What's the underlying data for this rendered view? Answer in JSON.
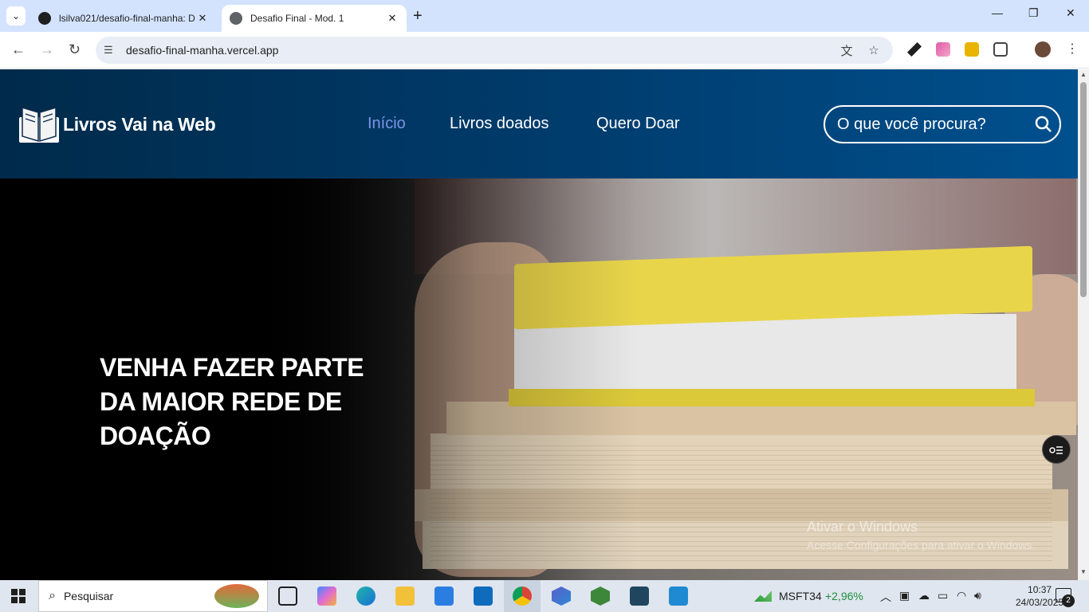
{
  "browser": {
    "tabs": [
      {
        "title": "lsilva021/desafio-final-manha: D",
        "icon": "github-icon"
      },
      {
        "title": "Desafio Final - Mod. 1",
        "icon": "globe-icon"
      }
    ],
    "url": "desafio-final-manha.vercel.app"
  },
  "site": {
    "logo_text": "Livros Vai na Web",
    "nav": [
      "Início",
      "Livros doados",
      "Quero Doar"
    ],
    "active_nav": "Início",
    "search_placeholder": "O que você procura?",
    "hero_title": "VENHA FAZER PARTE DA MAIOR REDE DE DOAÇÃO"
  },
  "watermark": {
    "line1": "Ativar o Windows",
    "line2": "Acesse Configurações para ativar o Windows."
  },
  "taskbar": {
    "search_text": "Pesquisar",
    "stock_symbol": "MSFT34",
    "stock_change": "+2,96%",
    "time": "10:37",
    "date": "24/03/2025",
    "notifications": "2"
  },
  "colors": {
    "header_start": "#002a4a",
    "header_end": "#00508e",
    "active_nav": "#7d95e6"
  }
}
